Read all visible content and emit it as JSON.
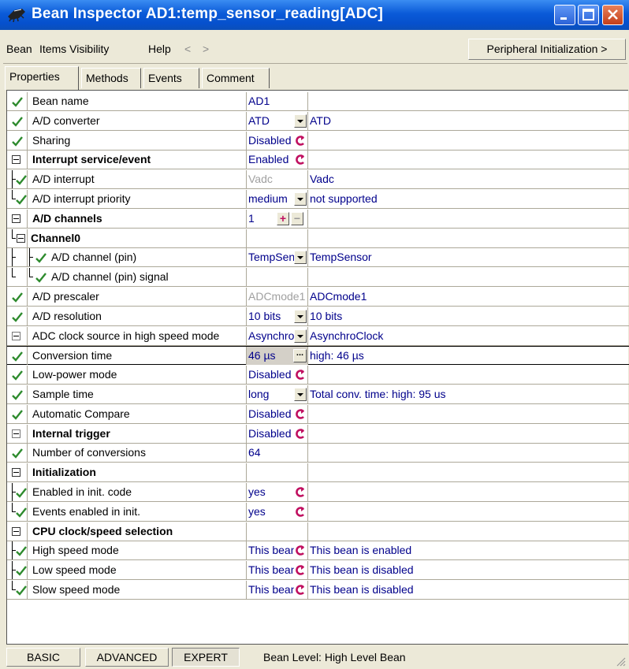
{
  "window": {
    "title": "Bean Inspector AD1:temp_sensor_reading[ADC]"
  },
  "menu": {
    "items": [
      "Bean",
      "Items Visibility",
      "Help"
    ],
    "back": "<",
    "forward": ">",
    "right_button": "Peripheral Initialization >"
  },
  "tabs": [
    "Properties",
    "Methods",
    "Events",
    "Comment"
  ],
  "colors": {
    "check": "#2e8b2e",
    "value_text": "#00008b",
    "disabled_text": "#a0a0a0",
    "toggle": "#c01060"
  },
  "rows": [
    {
      "check": true,
      "label": "Bean name",
      "value": "AD1",
      "desc": ""
    },
    {
      "check": true,
      "label": "A/D converter",
      "value": "ATD",
      "control": "dropdown",
      "desc": "ATD"
    },
    {
      "check": true,
      "label": "Sharing",
      "value": "Disabled",
      "control": "toggle",
      "desc": ""
    },
    {
      "group": true,
      "label": "Interrupt service/event",
      "value": "Enabled",
      "control": "toggle",
      "desc": ""
    },
    {
      "check": true,
      "label": "A/D interrupt",
      "value": "Vadc",
      "value_gray": true,
      "desc": "Vadc"
    },
    {
      "check": true,
      "label": "A/D interrupt priority",
      "value": "medium",
      "control": "dropdown",
      "desc": "not supported"
    },
    {
      "group": true,
      "label": "A/D channels",
      "value": "1",
      "control": "plusminus",
      "desc": ""
    },
    {
      "group": true,
      "label": "Channel0",
      "value": "",
      "desc": ""
    },
    {
      "check": true,
      "label": "A/D channel (pin)",
      "value": "TempSensor",
      "control": "dropdown",
      "desc": "TempSensor"
    },
    {
      "check": true,
      "label": "A/D channel (pin) signal",
      "value": "",
      "desc": ""
    },
    {
      "check": true,
      "label": "A/D prescaler",
      "value": "ADCmode1",
      "value_gray": true,
      "desc": "ADCmode1"
    },
    {
      "check": true,
      "label": "A/D resolution",
      "value": "10 bits",
      "control": "dropdown",
      "desc": "10 bits"
    },
    {
      "groupgray": true,
      "label": "ADC clock source in high speed mode",
      "value": "AsynchroClock",
      "control": "dropdown",
      "desc": "AsynchroClock"
    },
    {
      "check": true,
      "label": "Conversion time",
      "value": "46 µs",
      "control": "ellipsis",
      "desc": "high: 46 µs"
    },
    {
      "check": true,
      "label": "Low-power mode",
      "value": "Disabled",
      "control": "toggle",
      "desc": ""
    },
    {
      "check": true,
      "label": "Sample time",
      "value": "long",
      "control": "dropdown",
      "desc": "Total conv. time: high: 95 us"
    },
    {
      "check": true,
      "label": "Automatic Compare",
      "value": "Disabled",
      "control": "toggle",
      "desc": ""
    },
    {
      "groupgray": true,
      "label": "Internal trigger",
      "value": "Disabled",
      "control": "toggle",
      "desc": ""
    },
    {
      "check": true,
      "label": "Number of conversions",
      "value": "64",
      "desc": ""
    },
    {
      "group": true,
      "label": "Initialization",
      "value": "",
      "desc": ""
    },
    {
      "check": true,
      "label": "Enabled in init. code",
      "value": "yes",
      "control": "toggle",
      "desc": ""
    },
    {
      "check": true,
      "label": "Events enabled in init.",
      "value": "yes",
      "control": "toggle",
      "desc": ""
    },
    {
      "group": true,
      "label": "CPU clock/speed selection",
      "value": "",
      "desc": ""
    },
    {
      "check": true,
      "label": "High speed mode",
      "value": "This bean is enabled",
      "control": "toggle",
      "desc": "This bean is enabled"
    },
    {
      "check": true,
      "label": "Low speed mode",
      "value": "This bean is disabled",
      "control": "toggle",
      "desc": "This bean is disabled"
    },
    {
      "check": true,
      "label": "Slow speed mode",
      "value": "This bean is disabled",
      "control": "toggle",
      "desc": "This bean is disabled"
    }
  ],
  "status": {
    "basic": "BASIC",
    "advanced": "ADVANCED",
    "expert": "EXPERT",
    "level_text": "Bean Level: High Level Bean"
  }
}
